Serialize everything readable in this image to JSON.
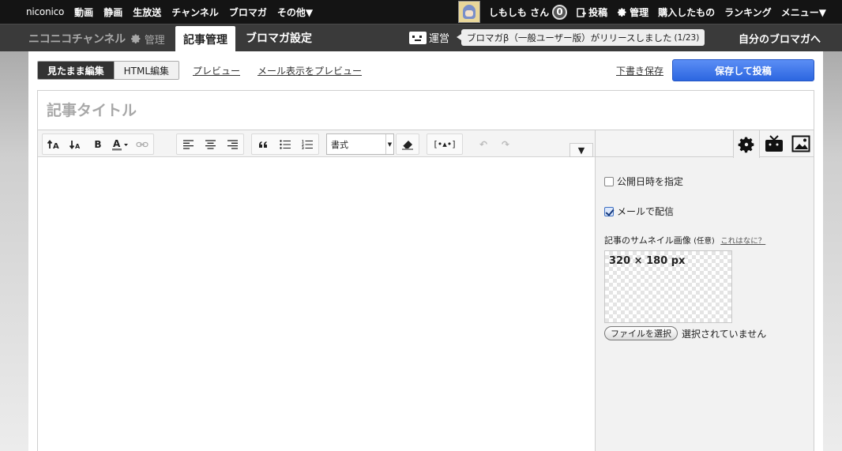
{
  "topnav": {
    "brand": "niconico",
    "links": [
      "動画",
      "静画",
      "生放送",
      "チャンネル",
      "ブロマガ",
      "その他▼"
    ],
    "user_name": "しもしも さん",
    "notification_count": "0",
    "post_label": "投稿",
    "manage_label": "管理",
    "purchased_label": "購入したもの",
    "ranking_label": "ランキング",
    "menu_label": "メニュー▼"
  },
  "subnav": {
    "channel_logo": "ニコニコチャンネル",
    "channel_manage": "管理",
    "tab_articles": "記事管理",
    "tab_settings": "ブロマガ設定",
    "unei_label": "運営",
    "notice_text": "ブロマガβ（一般ユーザー版）がリリースしました",
    "notice_count": "(1/23)",
    "my_blomaga": "自分のブロマガへ"
  },
  "editor": {
    "mode_wysiwyg": "見たまま編集",
    "mode_html": "HTML編集",
    "preview": "プレビュー",
    "mail_preview": "メール表示をプレビュー",
    "save_draft": "下書き保存",
    "submit": "保存して投稿",
    "title_placeholder": "記事タイトル",
    "format_select": "書式",
    "toolbar": {
      "font_up": "tA",
      "font_down": "tA",
      "bold": "B",
      "color": "A",
      "link": "⚯",
      "quote": "❝",
      "emoticon": "[•▴•]",
      "undo": "↶",
      "redo": "↷",
      "more": "▼"
    }
  },
  "sidebar": {
    "schedule_label": "公開日時を指定",
    "schedule_checked": false,
    "mail_label": "メールで配信",
    "mail_checked": true,
    "thumbnail_label": "記事のサムネイル画像",
    "thumbnail_optional": "(任意)",
    "thumbnail_help": "これはなに？",
    "thumbnail_size": "320 × 180 px",
    "file_button": "ファイルを選択",
    "file_status": "選択されていません"
  },
  "colors": {
    "topbar_bg": "#141414",
    "subbar_bg": "#3a3a3a",
    "accent_blue": "#2c66e0"
  }
}
